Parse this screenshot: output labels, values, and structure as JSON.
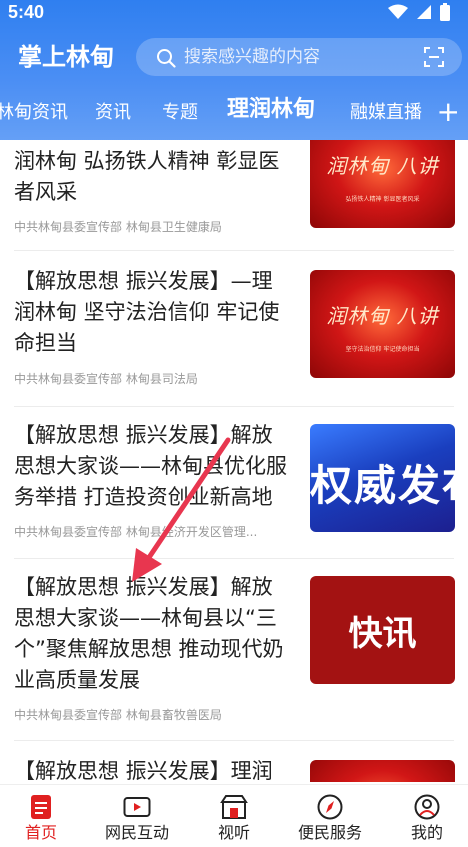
{
  "status_bar": {
    "time": "5:40"
  },
  "header": {
    "app_title": "掌上林甸",
    "search_placeholder": "搜索感兴趣的内容"
  },
  "tabs": [
    {
      "label": "林甸资讯"
    },
    {
      "label": "资讯"
    },
    {
      "label": "专题"
    },
    {
      "label": "理润林甸",
      "active": true
    },
    {
      "label": "融媒直播"
    }
  ],
  "tabs_more": "+",
  "articles": [
    {
      "title": "润林甸 弘扬铁人精神 彰显医者风采",
      "meta": "中共林甸县委宣传部 林甸县卫生健康局",
      "thumb_caption": "润林甸 八讲",
      "thumb_sub": "弘扬铁人精神 彰显医者风采"
    },
    {
      "title": "【解放思想 振兴发展】—理润林甸 坚守法治信仰 牢记使命担当",
      "meta": "中共林甸县委宣传部 林甸县司法局",
      "thumb_caption": "润林甸 八讲",
      "thumb_sub": "坚守法治信仰 牢记使命担当"
    },
    {
      "title": "【解放思想 振兴发展】解放思想大家谈——林甸县优化服务举措 打造投资创业新高地",
      "meta": "中共林甸县委宣传部 林甸县经济开发区管理...",
      "thumb_caption": "权威发布"
    },
    {
      "title": "【解放思想 振兴发展】解放思想大家谈——林甸县以“三个”聚焦解放思想 推动现代奶业高质量发展",
      "meta": "中共林甸县委宣传部 林甸县畜牧兽医局",
      "thumb_caption": "快讯"
    },
    {
      "title": "【解放思想 振兴发展】理润",
      "meta": ""
    }
  ],
  "bottom_nav": [
    {
      "label": "首页",
      "icon": "home-doc-icon",
      "active": true
    },
    {
      "label": "网民互动",
      "icon": "video-icon"
    },
    {
      "label": "视听",
      "icon": "tv-store-icon"
    },
    {
      "label": "便民服务",
      "icon": "compass-icon"
    },
    {
      "label": "我的",
      "icon": "user-icon"
    }
  ],
  "colors": {
    "brand_blue": "#2f7ff0",
    "active_red": "#e02020",
    "annotation_arrow": "#e8364f"
  }
}
